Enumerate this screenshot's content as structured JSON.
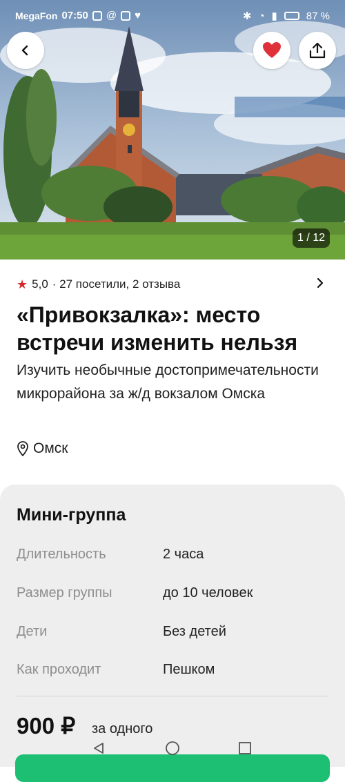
{
  "status_bar": {
    "carrier": "MegaFon",
    "time": "07:50",
    "battery": "87 %"
  },
  "hero": {
    "photo_counter": "1 / 12"
  },
  "rating": {
    "score": "5,0",
    "summary": "· 27 посетили, 2 отзыва"
  },
  "title": "«Привокзалка»: место встречи изменить нельзя",
  "subtitle": "Изучить необычные достопримечательности микрорайона за ж/д вокзалом Омска",
  "location": "Омск",
  "details": {
    "format": "Мини-группа",
    "rows": [
      {
        "label": "Длительность",
        "value": "2 часа"
      },
      {
        "label": "Размер группы",
        "value": "до 10 человек"
      },
      {
        "label": "Дети",
        "value": "Без детей"
      },
      {
        "label": "Как проходит",
        "value": "Пешком"
      }
    ],
    "price": "900 ₽",
    "price_note": "за одного"
  },
  "colors": {
    "accent_red": "#d5252d",
    "cta_green": "#1dbf73"
  }
}
